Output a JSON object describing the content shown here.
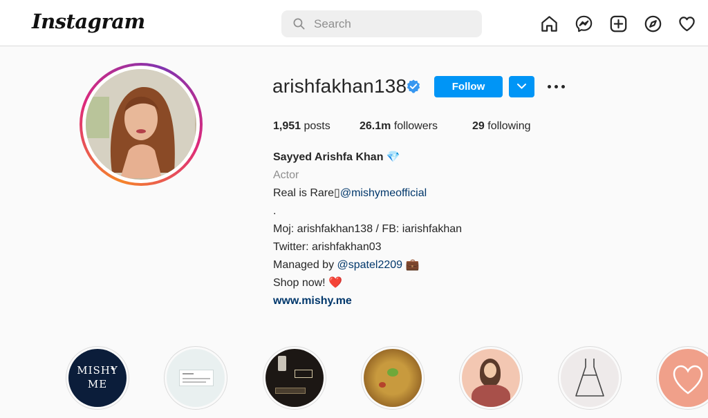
{
  "header": {
    "logo": "Instagram",
    "search_placeholder": "Search",
    "nav_icons": [
      "home-icon",
      "messenger-icon",
      "new-post-icon",
      "explore-icon",
      "activity-icon"
    ]
  },
  "profile": {
    "username": "arishfakhan138",
    "verified": true,
    "follow_label": "Follow",
    "accent": "#0095f6",
    "stats": {
      "posts_count": "1,951",
      "posts_label": "posts",
      "followers_count": "26.1m",
      "followers_label": "followers",
      "following_count": "29",
      "following_label": "following"
    },
    "bio": {
      "full_name": "Sayyed Arishfa Khan 💎",
      "category": "Actor",
      "line1_text": "Real is Rare▯",
      "line1_mention": "@mishymeofficial",
      "line2": ".",
      "line3": "Moj: arishfakhan138 / FB: iarishfakhan",
      "line4": "Twitter: arishfakhan03",
      "line5_text": "Managed by ",
      "line5_mention": "@spatel2209",
      "line5_emoji": "💼",
      "line6_text": "Shop now! ",
      "line6_emoji": "❤️",
      "website": "www.mishy.me"
    }
  },
  "highlights": [
    {
      "name": "highlight-mishy-logo",
      "logo_line1": "MISHY",
      "logo_line2": "ME",
      "bg": "#0b1d3a"
    },
    {
      "name": "highlight-tweet"
    },
    {
      "name": "highlight-product"
    },
    {
      "name": "highlight-food"
    },
    {
      "name": "highlight-illustration"
    },
    {
      "name": "highlight-dress"
    },
    {
      "name": "highlight-heart"
    }
  ]
}
